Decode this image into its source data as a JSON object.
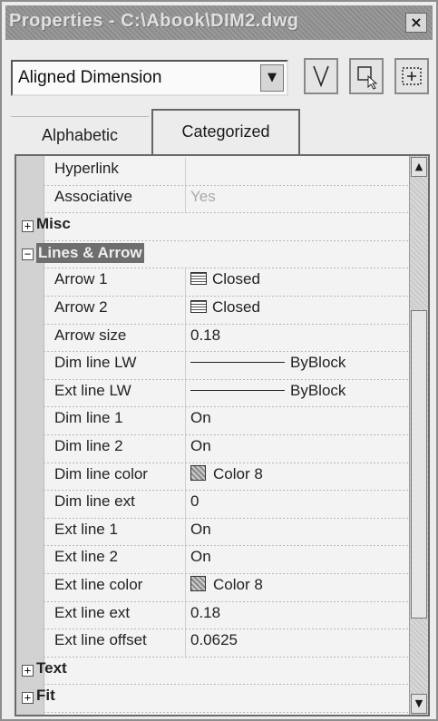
{
  "window": {
    "title": "Properties - C:\\Abook\\DIM2.dwg",
    "close_glyph": "×"
  },
  "selector": {
    "object_type": "Aligned Dimension",
    "buttons": [
      {
        "name": "quick-select-icon",
        "glyph": "∇"
      },
      {
        "name": "select-objects-icon",
        "glyph": "⬚"
      },
      {
        "name": "pickadd-icon",
        "glyph": "⊞"
      }
    ]
  },
  "tabs": {
    "alphabetic": "Alphabetic",
    "categorized": "Categorized"
  },
  "rows": [
    {
      "type": "prop",
      "name": "Hyperlink",
      "value": ""
    },
    {
      "type": "prop",
      "name": "Associative",
      "value": "Yes",
      "disabled": true
    },
    {
      "type": "cat",
      "name": "Misc",
      "expanded": false
    },
    {
      "type": "cat",
      "name": "Lines & Arrow",
      "expanded": true,
      "selected": true
    },
    {
      "type": "prop",
      "name": "Arrow 1",
      "value": "Closed",
      "icon": "arrow"
    },
    {
      "type": "prop",
      "name": "Arrow 2",
      "value": "Closed",
      "icon": "arrow"
    },
    {
      "type": "prop",
      "name": "Arrow size",
      "value": "0.18"
    },
    {
      "type": "prop",
      "name": "Dim line LW",
      "value": "ByBlock",
      "icon": "lineweight"
    },
    {
      "type": "prop",
      "name": "Ext line LW",
      "value": "ByBlock",
      "icon": "lineweight"
    },
    {
      "type": "prop",
      "name": "Dim line 1",
      "value": "On"
    },
    {
      "type": "prop",
      "name": "Dim line 2",
      "value": "On"
    },
    {
      "type": "prop",
      "name": "Dim line color",
      "value": "Color 8",
      "icon": "swatch"
    },
    {
      "type": "prop",
      "name": "Dim line ext",
      "value": "0"
    },
    {
      "type": "prop",
      "name": "Ext line 1",
      "value": "On"
    },
    {
      "type": "prop",
      "name": "Ext line 2",
      "value": "On"
    },
    {
      "type": "prop",
      "name": "Ext line color",
      "value": "Color 8",
      "icon": "swatch"
    },
    {
      "type": "prop",
      "name": "Ext line ext",
      "value": "0.18"
    },
    {
      "type": "prop",
      "name": "Ext line offset",
      "value": "0.0625"
    },
    {
      "type": "cat",
      "name": "Text",
      "expanded": false
    },
    {
      "type": "cat",
      "name": "Fit",
      "expanded": false
    }
  ],
  "scrollbar": {
    "up_glyph": "▲",
    "down_glyph": "▼"
  }
}
